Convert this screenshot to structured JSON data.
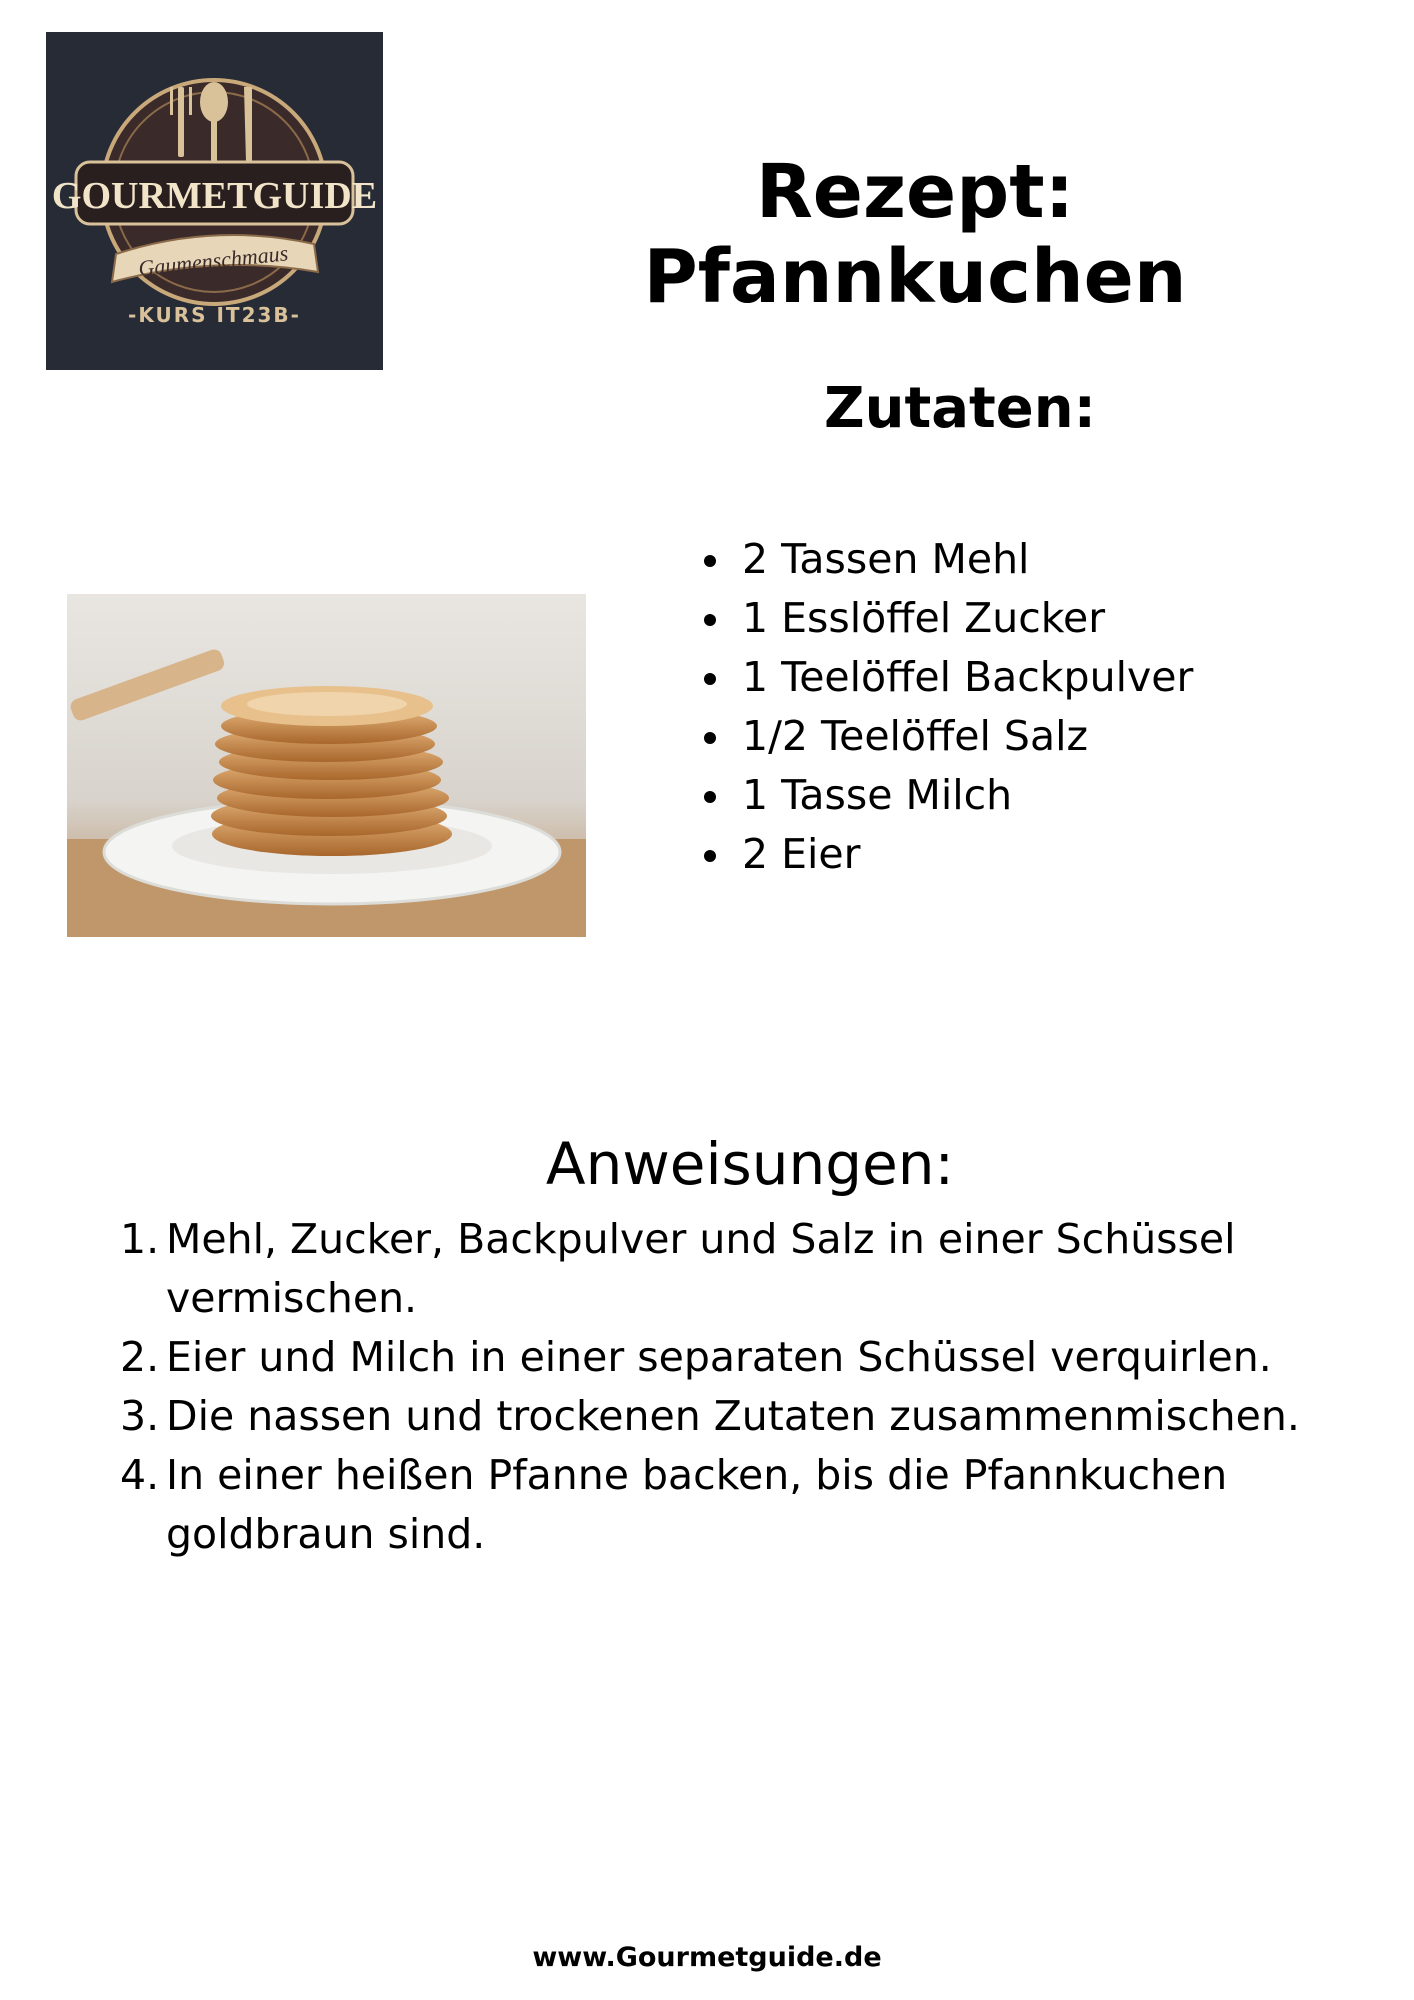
{
  "logo": {
    "brand": "GOURMETGUIDE",
    "tagline": "Gaumenschmaus",
    "course": "-KURS IT23B-"
  },
  "title": "Rezept: Pfannkuchen",
  "ingredients": {
    "heading": "Zutaten:",
    "items": [
      "2 Tassen Mehl",
      "1 Esslöffel Zucker",
      "1 Teelöffel Backpulver",
      "1/2 Teelöffel Salz",
      "1 Tasse Milch",
      "2 Eier"
    ]
  },
  "instructions": {
    "heading": "Anweisungen:",
    "steps": [
      {
        "num": "1.",
        "text": "Mehl, Zucker, Backpulver und Salz in einer Schüssel vermischen."
      },
      {
        "num": "2.",
        "text": "Eier und Milch in einer separaten Schüssel verquirlen."
      },
      {
        "num": "3.",
        "text": "Die nassen und trockenen Zutaten zusammenmischen."
      },
      {
        "num": "4.",
        "text": "In einer heißen Pfanne backen, bis die Pfannkuchen goldbraun sind."
      }
    ]
  },
  "footer": "www.Gourmetguide.de"
}
